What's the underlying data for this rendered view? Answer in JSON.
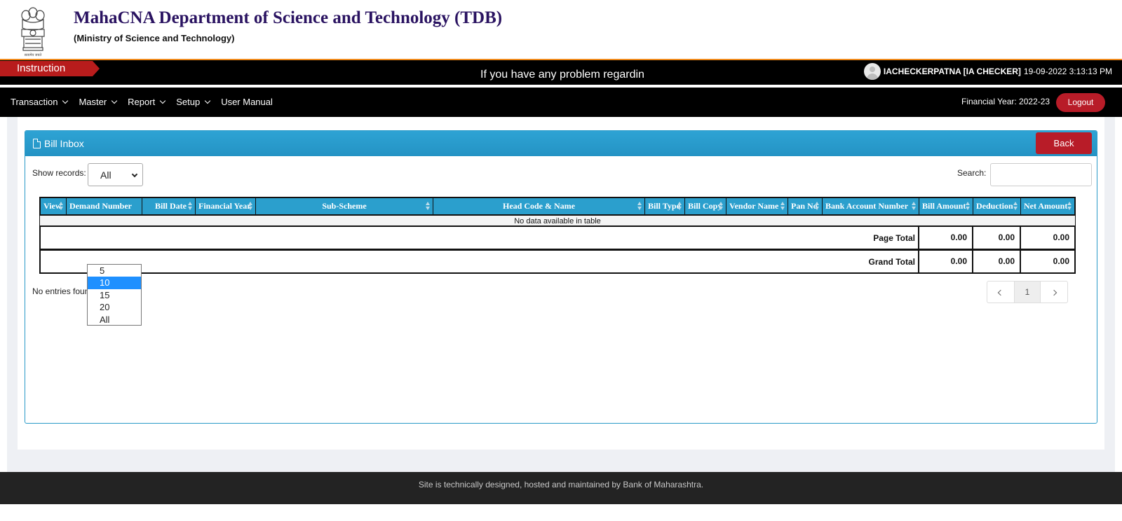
{
  "header": {
    "title": "MahaCNA Department of Science and Technology (TDB)",
    "subtitle": "(Ministry of Science and Technology)",
    "emblem_caption": "सत्यमेव जयते"
  },
  "instruction_bar": {
    "tag_label": "Instruction",
    "marquee_text": "If you have any problem regardin",
    "user_name": "IACHECKERPATNA [IA CHECKER]",
    "datetime": "19-09-2022 3:13:13 PM"
  },
  "nav": {
    "items": [
      {
        "label": "Transaction",
        "has_dropdown": true
      },
      {
        "label": "Master",
        "has_dropdown": true
      },
      {
        "label": "Report",
        "has_dropdown": true
      },
      {
        "label": "Setup",
        "has_dropdown": true
      },
      {
        "label": "User Manual",
        "has_dropdown": false
      }
    ],
    "financial_year": "Financial Year: 2022-23",
    "logout_label": "Logout"
  },
  "panel": {
    "title": "Bill Inbox",
    "back_label": "Back",
    "show_records_label": "Show records:",
    "show_records_value": "All",
    "search_label": "Search:",
    "search_value": ""
  },
  "table": {
    "columns": [
      "View",
      "Demand Number",
      "Bill Date",
      "Financial Year",
      "Sub-Scheme",
      "Head Code & Name",
      "Bill Type",
      "Bill Copy",
      "Vendor Name",
      "Pan No",
      "Bank Account Number",
      "Bill Amount",
      "Deduction",
      "Net Amount"
    ],
    "empty_message": "No data available in table",
    "page_total": {
      "label": "Page Total",
      "bill_amount": "0.00",
      "deduction": "0.00",
      "net_amount": "0.00"
    },
    "grand_total": {
      "label": "Grand Total",
      "bill_amount": "0.00",
      "deduction": "0.00",
      "net_amount": "0.00"
    }
  },
  "entries_info": "No entries foun",
  "pagination": {
    "prev": "‹",
    "current": "1",
    "next": "›"
  },
  "records_dropdown": {
    "options": [
      "5",
      "10",
      "15",
      "20",
      "All"
    ],
    "highlighted": "10"
  },
  "footer": {
    "text": "Site is technically designed, hosted and maintained by Bank of Maharashtra."
  },
  "colors": {
    "title_color": "#2a1361",
    "accent_red": "#b81c28",
    "header_blue": "#2b9fcd",
    "orange_line": "#f08a1c"
  }
}
